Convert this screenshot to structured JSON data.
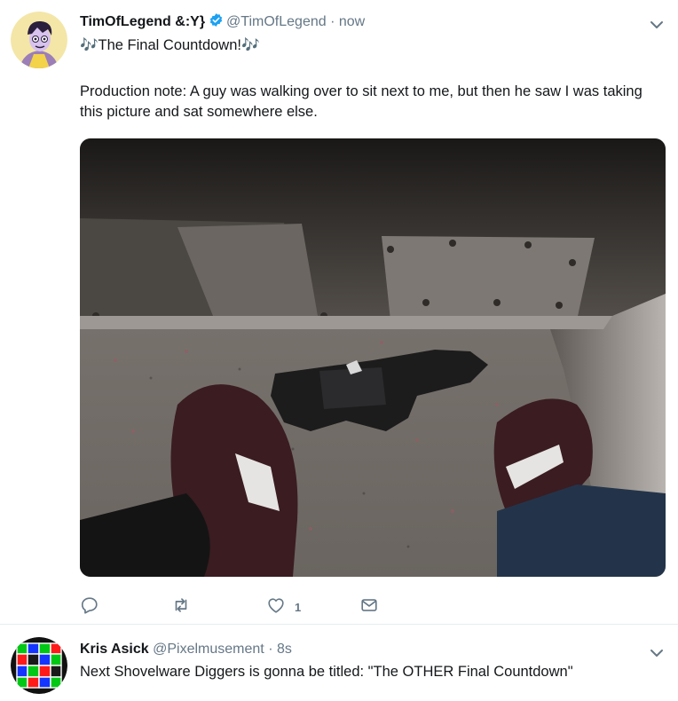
{
  "tweet1": {
    "display_name": "TimOfLegend &:Y}",
    "handle": "@TimOfLegend",
    "separator": "·",
    "time": "now",
    "headline": "🎶The Final Countdown!🎶",
    "body": "Production note: A guy was walking over to sit next to me, but then he saw I was taking this picture and sat somewhere else.",
    "actions": {
      "reply_count": "",
      "retweet_count": "",
      "like_count": "1",
      "dm_count": ""
    }
  },
  "tweet2": {
    "display_name": "Kris Asick",
    "handle": "@Pixelmusement",
    "separator": "·",
    "time": "8s",
    "body": "Next Shovelware Diggers is gonna be titled: \"The OTHER Final Countdown\""
  },
  "icons": {
    "verified": "verified-badge-icon",
    "caret": "chevron-down-icon",
    "reply": "reply-icon",
    "retweet": "retweet-icon",
    "like": "heart-icon",
    "dm": "envelope-icon"
  },
  "colors": {
    "accent": "#1da1f2",
    "muted": "#657786",
    "text": "#14171a",
    "divider": "#e6ecf0"
  }
}
